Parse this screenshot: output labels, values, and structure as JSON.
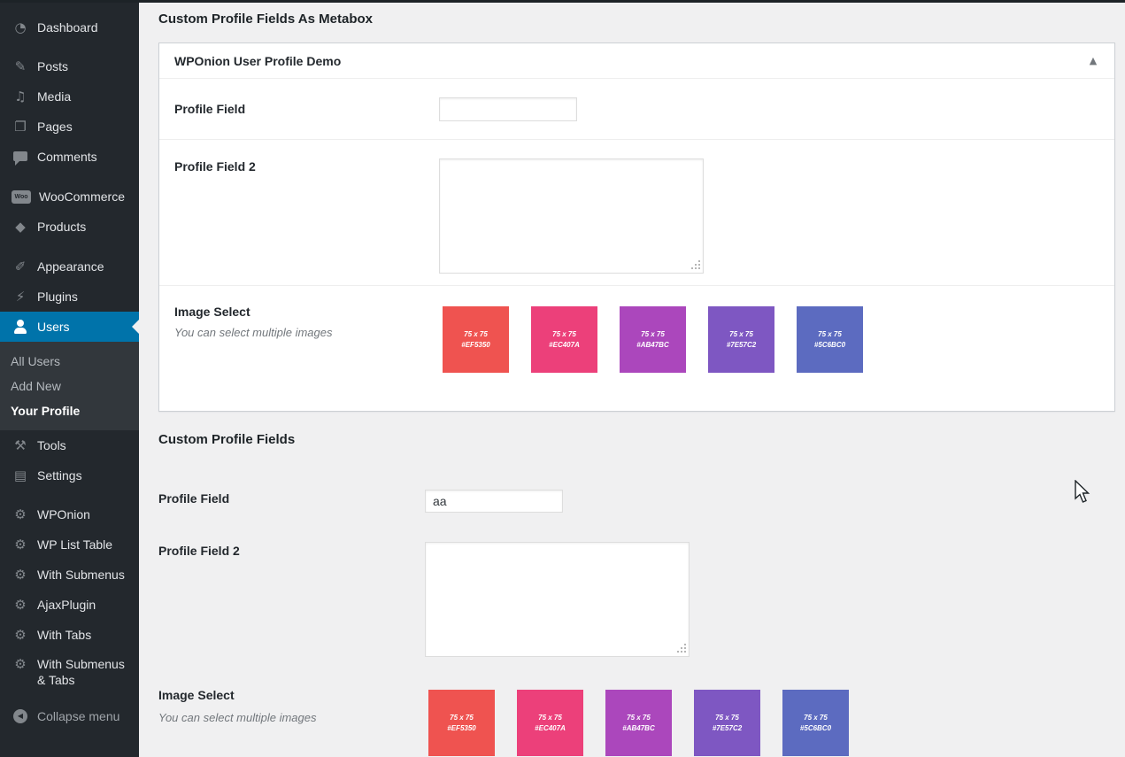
{
  "sidebar": {
    "items": [
      {
        "label": "Dashboard",
        "glyph": "◔"
      },
      {
        "label": "Posts",
        "glyph": "✎"
      },
      {
        "label": "Media",
        "glyph": "♫"
      },
      {
        "label": "Pages",
        "glyph": "❐"
      },
      {
        "label": "Comments",
        "glyph": ""
      },
      {
        "label": "WooCommerce",
        "glyph": "Woo"
      },
      {
        "label": "Products",
        "glyph": "◆"
      },
      {
        "label": "Appearance",
        "glyph": "✐"
      },
      {
        "label": "Plugins",
        "glyph": "⚡"
      },
      {
        "label": "Users",
        "glyph": ""
      },
      {
        "label": "Tools",
        "glyph": "⚒"
      },
      {
        "label": "Settings",
        "glyph": "▤"
      },
      {
        "label": "WPOnion",
        "glyph": "⚙"
      },
      {
        "label": "WP List Table",
        "glyph": "⚙"
      },
      {
        "label": "With Submenus",
        "glyph": "⚙"
      },
      {
        "label": "AjaxPlugin",
        "glyph": "⚙"
      },
      {
        "label": "With Tabs",
        "glyph": "⚙"
      },
      {
        "label": "With Submenus & Tabs",
        "glyph": "⚙"
      },
      {
        "label": "Collapse menu",
        "glyph": "◀"
      }
    ],
    "users_submenu": [
      {
        "label": "All Users"
      },
      {
        "label": "Add New"
      },
      {
        "label": "Your Profile"
      }
    ]
  },
  "content": {
    "section1": {
      "heading": "Custom Profile Fields As Metabox",
      "metabox_title": "WPOnion User Profile Demo",
      "toggle_glyph": "▲",
      "field1_label": "Profile Field",
      "field1_value": "",
      "field2_label": "Profile Field 2",
      "field2_value": "",
      "image_select_label": "Image Select",
      "image_select_desc": "You can select multiple images"
    },
    "section2": {
      "heading": "Custom Profile Fields",
      "field1_label": "Profile Field",
      "field1_value": "aa",
      "field2_label": "Profile Field 2",
      "field2_value": "",
      "image_select_label": "Image Select",
      "image_select_desc": "You can select multiple images"
    },
    "images": [
      {
        "size": "75 x 75",
        "hex": "#EF5350",
        "color": "#EF5350"
      },
      {
        "size": "75 x 75",
        "hex": "#EC407A",
        "color": "#EC407A"
      },
      {
        "size": "75 x 75",
        "hex": "#AB47BC",
        "color": "#AB47BC"
      },
      {
        "size": "75 x 75",
        "hex": "#7E57C2",
        "color": "#7E57C2"
      },
      {
        "size": "75 x 75",
        "hex": "#5C6BC0",
        "color": "#5C6BC0"
      }
    ],
    "colors": {
      "accent_blue": "#0073aa",
      "sidebar_bg": "#23282d",
      "content_bg": "#f0f0f1"
    }
  }
}
